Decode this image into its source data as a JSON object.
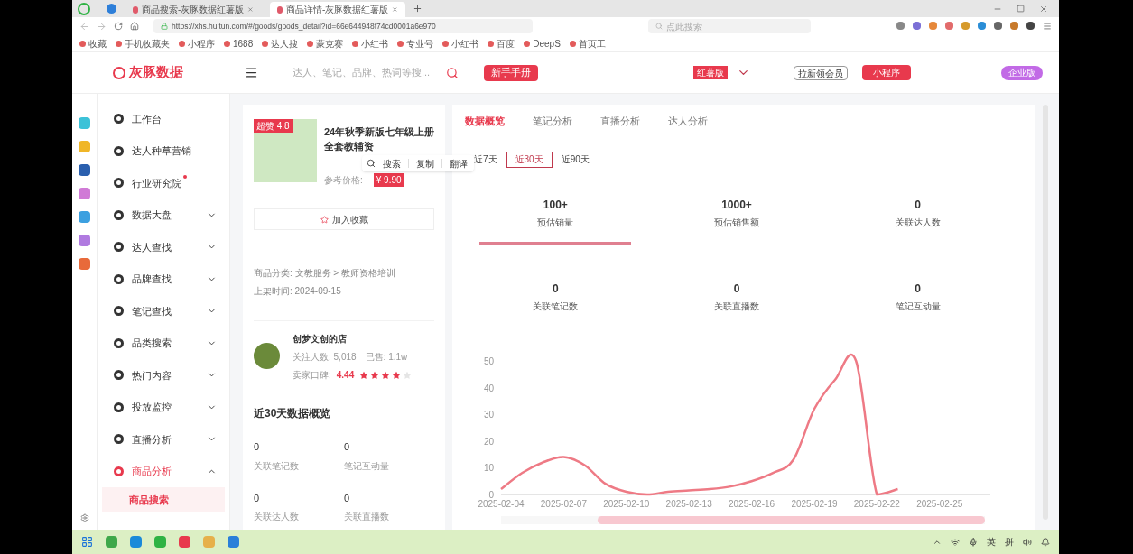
{
  "browser": {
    "tabs": [
      {
        "title": "商品搜索-灰豚数据红薯版",
        "selected": false
      },
      {
        "title": "商品详情-灰豚数据红薯版",
        "selected": true
      }
    ],
    "url": "https://xhs.huitun.com/#/goods/goods_detail?id=66e644948f74cd0001a6e970",
    "search_placeholder": "点此搜索",
    "bookmarks": [
      "收藏",
      "手机收藏夹",
      "小程序",
      "1688",
      "达人搜",
      "蒙克赛",
      "小红书",
      "专业号",
      "小红书",
      "百度",
      "DeepS",
      "首页工"
    ]
  },
  "header": {
    "logo": "灰豚数据",
    "search_placeholder": "达人、笔记、品牌、热词等搜...",
    "guide_button": "新手手册",
    "edition": "红薯版",
    "invite_button": "拉新领会员",
    "mini_program_button": "小程序",
    "enterprise_button": "企业版"
  },
  "sidebar": {
    "items": [
      {
        "label": "工作台",
        "kind": "link",
        "active": false,
        "dot": false
      },
      {
        "label": "达人种草营销",
        "kind": "link",
        "active": false,
        "dot": false
      },
      {
        "label": "行业研究院",
        "kind": "link",
        "active": false,
        "dot": true
      },
      {
        "label": "数据大盘",
        "kind": "menu",
        "active": false,
        "dot": false,
        "expanded": false
      },
      {
        "label": "达人查找",
        "kind": "menu",
        "active": false,
        "dot": false,
        "expanded": false
      },
      {
        "label": "品牌查找",
        "kind": "menu",
        "active": false,
        "dot": false,
        "expanded": false
      },
      {
        "label": "笔记查找",
        "kind": "menu",
        "active": false,
        "dot": false,
        "expanded": false
      },
      {
        "label": "品类搜索",
        "kind": "menu",
        "active": false,
        "dot": false,
        "expanded": false
      },
      {
        "label": "热门内容",
        "kind": "menu",
        "active": false,
        "dot": false,
        "expanded": false
      },
      {
        "label": "投放监控",
        "kind": "menu",
        "active": false,
        "dot": false,
        "expanded": false
      },
      {
        "label": "直播分析",
        "kind": "menu",
        "active": false,
        "dot": false,
        "expanded": false
      },
      {
        "label": "商品分析",
        "kind": "menu",
        "active": true,
        "dot": false,
        "expanded": true,
        "children": [
          {
            "label": "商品搜索",
            "selected": true
          }
        ]
      }
    ]
  },
  "product": {
    "badge": "超赞",
    "score": "4.8",
    "title": "24年秋季新版七年级上册全套教辅资",
    "price_label": "参考价格:",
    "price": "¥ 9.90",
    "context_menu": [
      "搜索",
      "复制",
      "翻译"
    ],
    "favorite_button": "加入收藏",
    "category": "商品分类: 文教服务 > 教师资格培训",
    "listed": "上架时间: 2024-09-15",
    "shop": {
      "name": "创梦文创的店",
      "followers": "关注人数: 5,018",
      "sold": "已售: 1.1w",
      "rating_label": "卖家口碑:",
      "rating": "4.44",
      "stars": 4
    },
    "overview_title": "近30天数据概览",
    "overview": [
      {
        "value": "0",
        "label": "关联笔记数"
      },
      {
        "value": "0",
        "label": "笔记互动量"
      },
      {
        "value": "0",
        "label": "关联达人数"
      },
      {
        "value": "0",
        "label": "关联直播数"
      }
    ]
  },
  "analysis": {
    "tabs": [
      {
        "label": "数据概览",
        "selected": true
      },
      {
        "label": "笔记分析",
        "selected": false
      },
      {
        "label": "直播分析",
        "selected": false
      },
      {
        "label": "达人分析",
        "selected": false
      }
    ],
    "periods": [
      {
        "label": "近7天",
        "selected": false
      },
      {
        "label": "近30天",
        "selected": true
      },
      {
        "label": "近90天",
        "selected": false
      }
    ],
    "metrics": [
      {
        "value": "100+",
        "label": "预估销量",
        "selected": true
      },
      {
        "value": "1000+",
        "label": "预估销售额",
        "selected": false
      },
      {
        "value": "0",
        "label": "关联达人数",
        "selected": false
      },
      {
        "value": "0",
        "label": "关联笔记数",
        "selected": false
      },
      {
        "value": "0",
        "label": "关联直播数",
        "selected": false
      },
      {
        "value": "0",
        "label": "笔记互动量",
        "selected": false
      }
    ],
    "chart_data": {
      "type": "line",
      "categories": [
        "2025-02-04",
        null,
        null,
        "2025-02-07",
        null,
        null,
        "2025-02-10",
        null,
        null,
        "2025-02-13",
        null,
        null,
        "2025-02-16",
        null,
        null,
        "2025-02-19",
        null,
        null,
        "2025-02-22",
        null,
        null,
        "2025-02-25",
        null,
        null
      ],
      "series": [
        {
          "color": "#ee7a85",
          "values": [
            2,
            8,
            12,
            14,
            11,
            4,
            1,
            0,
            1,
            1.5,
            2,
            3,
            5,
            8,
            13,
            32,
            43,
            50,
            0,
            2,
            null,
            null,
            null,
            null
          ]
        }
      ],
      "ylim": [
        0,
        50
      ],
      "yticks": [
        0,
        10,
        20,
        30,
        40,
        50
      ]
    },
    "zoom_slider": {
      "level": 0.8
    }
  },
  "taskbar": {
    "tray": [
      "英",
      "拼"
    ]
  }
}
